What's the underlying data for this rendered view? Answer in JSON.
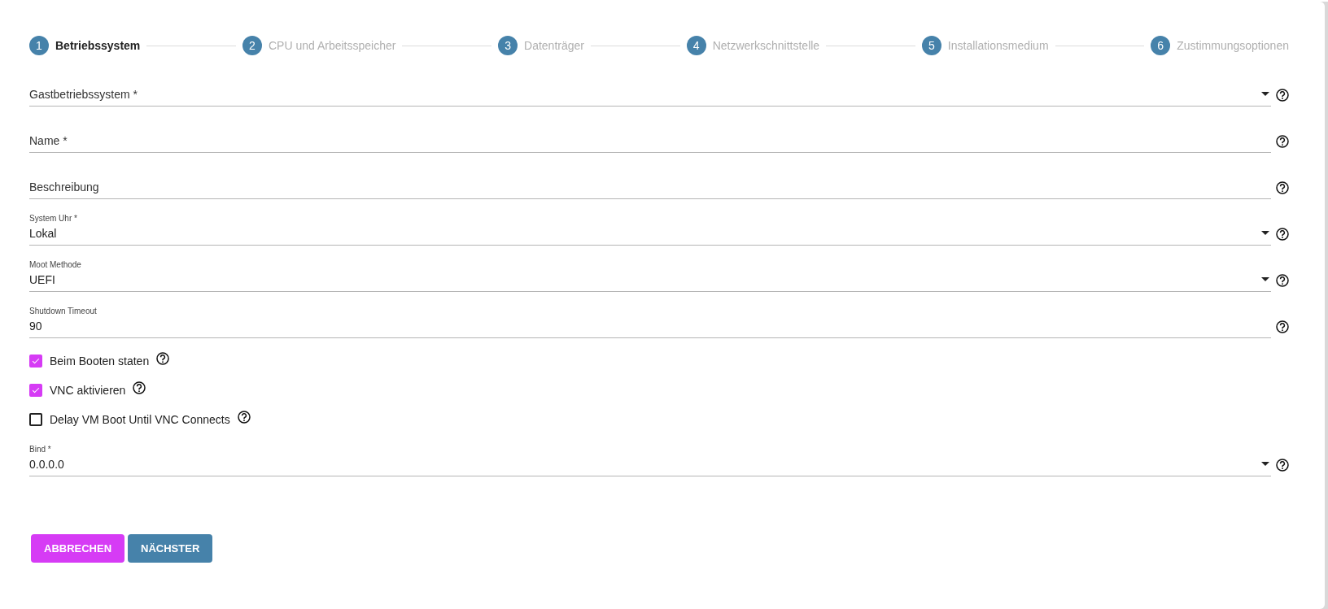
{
  "steps": [
    {
      "number": "1",
      "label": "Betriebssystem",
      "selected": true
    },
    {
      "number": "2",
      "label": "CPU und Arbeitsspeicher",
      "selected": false
    },
    {
      "number": "3",
      "label": "Datenträger",
      "selected": false
    },
    {
      "number": "4",
      "label": "Netzwerkschnittstelle",
      "selected": false
    },
    {
      "number": "5",
      "label": "Installationsmedium",
      "selected": false
    },
    {
      "number": "6",
      "label": "Zustimmungsoptionen",
      "selected": false
    }
  ],
  "form_items": [
    {
      "kind": "select",
      "label": "Gastbetriebssystem *"
    },
    {
      "kind": "text",
      "label": "Name *"
    },
    {
      "kind": "text",
      "label": "Beschreibung"
    },
    {
      "kind": "select",
      "label": "System Uhr *",
      "value": "Lokal"
    },
    {
      "kind": "select",
      "label": "Moot Methode",
      "value": "UEFI"
    },
    {
      "kind": "text",
      "label": "Shutdown Timeout",
      "value": "90"
    },
    {
      "kind": "checkbox",
      "label": "Beim Booten staten",
      "checked": true
    },
    {
      "kind": "checkbox",
      "label": "VNC aktivieren",
      "checked": true
    },
    {
      "kind": "checkbox",
      "label": "Delay VM Boot Until VNC Connects",
      "checked": false
    },
    {
      "kind": "select",
      "label": "Bind *",
      "value": "0.0.0.0"
    }
  ],
  "buttons": [
    {
      "kind": "cancel",
      "label": "ABBRECHEN"
    },
    {
      "kind": "next",
      "label": "NÄCHSTER"
    }
  ]
}
